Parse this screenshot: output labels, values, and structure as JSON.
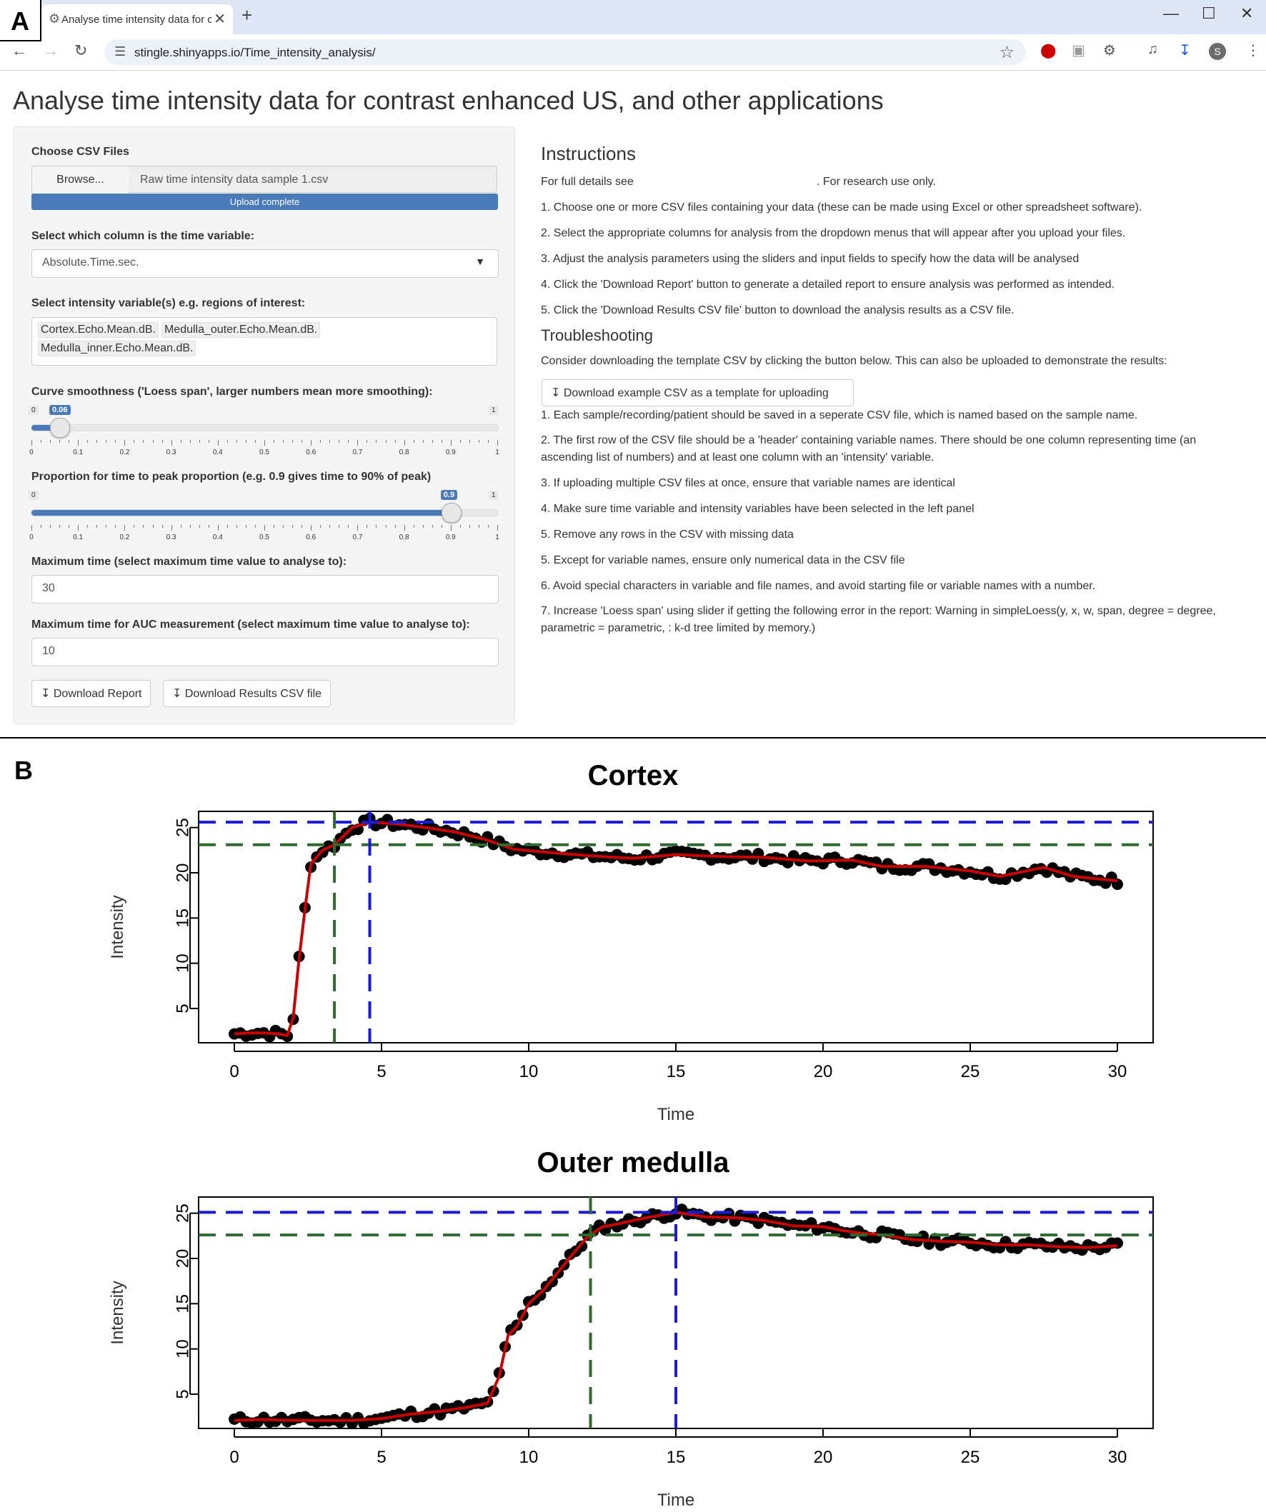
{
  "figure": {
    "panel_a": "A",
    "panel_b": "B"
  },
  "browser": {
    "tab_title": "Analyse time intensity data for c",
    "tab_close": "✕",
    "new_tab": "+",
    "url": "stingle.shinyapps.io/Time_intensity_analysis/",
    "window_controls": [
      "—",
      "☐",
      "✕"
    ],
    "profile_initial": "S"
  },
  "app": {
    "title": "Analyse time intensity data for contrast enhanced US, and other applications",
    "sidebar": {
      "csv_label": "Choose CSV Files",
      "browse_label": "Browse...",
      "file_name": "Raw time intensity data sample 1.csv",
      "upload_status": "Upload complete",
      "time_label": "Select which column is the time variable:",
      "time_value": "Absolute.Time.sec.",
      "intensity_label": "Select intensity variable(s) e.g. regions of interest:",
      "intensity_tags": [
        "Cortex.Echo.Mean.dB.",
        "Medulla_outer.Echo.Mean.dB.",
        "Medulla_inner.Echo.Mean.dB."
      ],
      "smooth_label": "Curve smoothness ('Loess span', larger numbers mean more smoothing):",
      "smooth_value": 0.06,
      "smooth_value_text": "0.06",
      "peak_label": "Proportion for time to peak proportion (e.g. 0.9 gives time to 90% of peak)",
      "peak_value": 0.9,
      "peak_value_text": "0.9",
      "slider_min": "0",
      "slider_max": "1",
      "slider_ticks": [
        "0",
        "0.1",
        "0.2",
        "0.3",
        "0.4",
        "0.5",
        "0.6",
        "0.7",
        "0.8",
        "0.9",
        "1"
      ],
      "max_time_label": "Maximum time (select maximum time value to analyse to):",
      "max_time_value": "30",
      "auc_label": "Maximum time for AUC measurement (select maximum time value to analyse to):",
      "auc_value": "10",
      "download_report": "Download Report",
      "download_csv": "Download Results CSV file"
    },
    "main": {
      "instructions_heading": "Instructions",
      "full_details_prefix": "For full details see",
      "full_details_suffix": ". For research use only.",
      "instructions": [
        "1. Choose one or more CSV files containing your data (these can be made using Excel or other spreadsheet software).",
        "2. Select the appropriate columns for analysis from the dropdown menus that will appear after you upload your files.",
        "3. Adjust the analysis parameters using the sliders and input fields to specify how the data will be analysed",
        "4. Click the 'Download Report' button to generate a detailed report to ensure analysis was performed as intended.",
        "5. Click the 'Download Results CSV file' button to download the analysis results as a CSV file."
      ],
      "troubleshooting_heading": "Troubleshooting",
      "troubleshooting_intro": "Consider downloading the template CSV by clicking the button below. This can also be uploaded to demonstrate the results:",
      "example_button": "Download example CSV as a template for uploading",
      "troubleshooting": [
        "1. Each sample/recording/patient should be saved in a seperate CSV file, which is named based on the sample name.",
        "2. The first row of the CSV file should be a 'header' containing variable names. There should be one column representing time (an ascending list of numbers) and at least one column with an 'intensity' variable.",
        "3. If uploading multiple CSV files at once, ensure that variable names are identical",
        "4. Make sure time variable and intensity variables have been selected in the left panel",
        "5. Remove any rows in the CSV with missing data",
        "5. Except for variable names, ensure only numerical data in the CSV file",
        "6. Avoid special characters in variable and file names, and avoid starting file or variable names with a number.",
        "7. Increase 'Loess span' using slider if getting the following error in the report: Warning in simpleLoess(y, x, w, span, degree = degree, parametric = parametric, : k-d tree limited by memory.)"
      ]
    }
  },
  "chart_data": [
    {
      "type": "scatter",
      "title": "Cortex",
      "xlabel": "Time",
      "ylabel": "Intensity",
      "xlim": [
        0,
        30
      ],
      "ylim": [
        2,
        26
      ],
      "xticks": [
        0,
        5,
        10,
        15,
        20,
        25,
        30
      ],
      "yticks": [
        5,
        10,
        15,
        20,
        25
      ],
      "peak_value": 25.6,
      "threshold_value": 23.1,
      "time_to_threshold": 3.4,
      "time_to_peak": 4.6,
      "key_points": [
        [
          0,
          2.2
        ],
        [
          0.5,
          2.3
        ],
        [
          1,
          2.3
        ],
        [
          1.5,
          2.2
        ],
        [
          1.8,
          2.0
        ],
        [
          2.0,
          4.0
        ],
        [
          2.2,
          10.5
        ],
        [
          2.4,
          16
        ],
        [
          2.6,
          21
        ],
        [
          3.0,
          22.5
        ],
        [
          3.4,
          23.1
        ],
        [
          4.0,
          25
        ],
        [
          4.6,
          25.6
        ],
        [
          5.5,
          25.4
        ],
        [
          6.5,
          25
        ],
        [
          7.5,
          24.5
        ],
        [
          8.5,
          23.7
        ],
        [
          9.5,
          22.6
        ],
        [
          10.5,
          22.3
        ],
        [
          12,
          21.9
        ],
        [
          13.5,
          21.6
        ],
        [
          15,
          22.0
        ],
        [
          16.5,
          21.8
        ],
        [
          18,
          21.7
        ],
        [
          19.5,
          21.3
        ],
        [
          21,
          21.4
        ],
        [
          22,
          20.7
        ],
        [
          23.5,
          20.7
        ],
        [
          25,
          20.2
        ],
        [
          26,
          19.6
        ],
        [
          27.5,
          20.6
        ],
        [
          28.5,
          19.6
        ],
        [
          30,
          19.1
        ]
      ],
      "colors": {
        "points": "#000000",
        "fit": "#cc0000",
        "peak": "#1a1adb",
        "threshold": "#2e6b2e"
      }
    },
    {
      "type": "scatter",
      "title": "Outer medulla",
      "xlabel": "Time",
      "ylabel": "Intensity",
      "xlim": [
        0,
        30
      ],
      "ylim": [
        2,
        26
      ],
      "xticks": [
        0,
        5,
        10,
        15,
        20,
        25,
        30
      ],
      "yticks": [
        5,
        10,
        15,
        20,
        25
      ],
      "peak_value": 25.1,
      "threshold_value": 22.6,
      "time_to_threshold": 12.1,
      "time_to_peak": 15.0,
      "key_points": [
        [
          0,
          2.1
        ],
        [
          1,
          2.2
        ],
        [
          2,
          2.1
        ],
        [
          3,
          2.1
        ],
        [
          4,
          2.1
        ],
        [
          5,
          2.3
        ],
        [
          6,
          2.8
        ],
        [
          7,
          3.1
        ],
        [
          8,
          3.6
        ],
        [
          8.6,
          4.0
        ],
        [
          9.0,
          7
        ],
        [
          9.3,
          11.5
        ],
        [
          9.6,
          12.5
        ],
        [
          10,
          15
        ],
        [
          10.5,
          16.5
        ],
        [
          11,
          18.5
        ],
        [
          11.5,
          20.5
        ],
        [
          12,
          22.4
        ],
        [
          12.5,
          23.5
        ],
        [
          13,
          23.8
        ],
        [
          14,
          24.5
        ],
        [
          14.5,
          24.8
        ],
        [
          15,
          25.1
        ],
        [
          16,
          24.6
        ],
        [
          17,
          24.5
        ],
        [
          18,
          24.2
        ],
        [
          19,
          23.6
        ],
        [
          20,
          23.5
        ],
        [
          21,
          22.9
        ],
        [
          22,
          22.6
        ],
        [
          23,
          22.1
        ],
        [
          24,
          21.9
        ],
        [
          25,
          21.8
        ],
        [
          26,
          21.5
        ],
        [
          27,
          21.5
        ],
        [
          28,
          21.3
        ],
        [
          29,
          21.2
        ],
        [
          30,
          21.4
        ]
      ],
      "colors": {
        "points": "#000000",
        "fit": "#cc0000",
        "peak": "#1a1adb",
        "threshold": "#2e6b2e"
      }
    }
  ]
}
